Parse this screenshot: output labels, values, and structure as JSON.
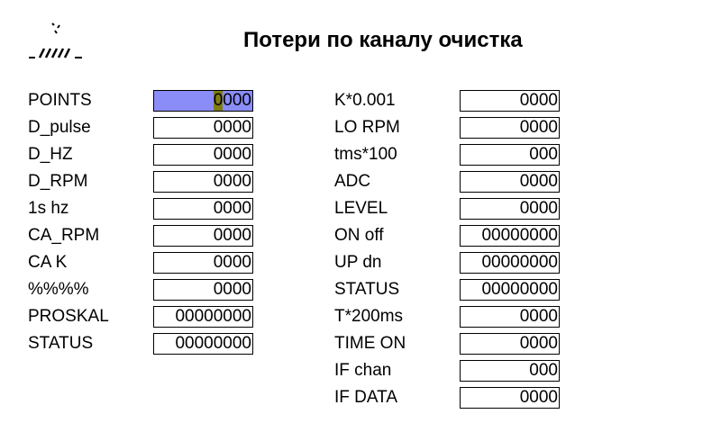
{
  "title": "Потери по каналу очистка",
  "left_rows": [
    {
      "label": "POINTS",
      "value": "0000",
      "active": true
    },
    {
      "label": "D_pulse",
      "value": "0000"
    },
    {
      "label": "D_HZ",
      "value": "0000"
    },
    {
      "label": "D_RPM",
      "value": "0000"
    },
    {
      "label": "1s hz",
      "value": "0000"
    },
    {
      "label": "CA_RPM",
      "value": "0000"
    },
    {
      "label": "CA K",
      "value": "0000"
    },
    {
      "label": "%%%%",
      "value": "0000"
    },
    {
      "label": "PROSKAL",
      "value": "00000000"
    },
    {
      "label": "STATUS",
      "value": "00000000"
    }
  ],
  "right_rows": [
    {
      "label": "K*0.001",
      "value": "0000"
    },
    {
      "label": "LO RPM",
      "value": "0000"
    },
    {
      "label": "tms*100",
      "value": "000"
    },
    {
      "label": "ADC",
      "value": "0000"
    },
    {
      "label": "LEVEL",
      "value": "0000"
    },
    {
      "label": "ON off",
      "value": "00000000"
    },
    {
      "label": "UP dn",
      "value": "00000000"
    },
    {
      "label": "STATUS",
      "value": "00000000"
    },
    {
      "label": "T*200ms",
      "value": "0000"
    },
    {
      "label": "TIME ON",
      "value": "0000"
    },
    {
      "label": "IF chan",
      "value": "000"
    },
    {
      "label": "IF DATA",
      "value": "0000"
    }
  ],
  "colors": {
    "active_field": "#8a8cf8",
    "cursor": "#7f7d12"
  },
  "icons": {
    "logo": "field-stripes-logo"
  }
}
